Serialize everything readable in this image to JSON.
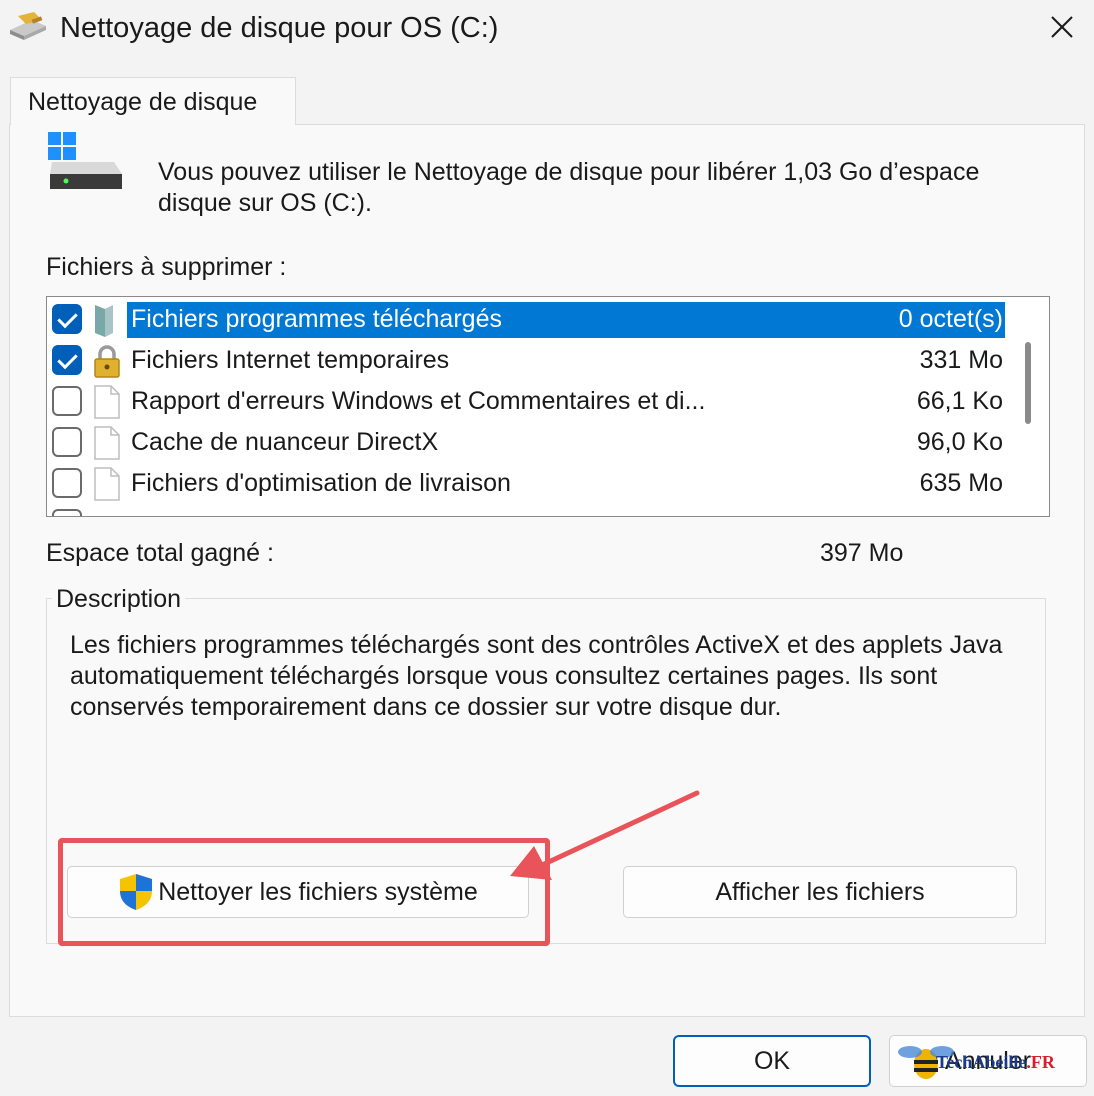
{
  "window": {
    "title": "Nettoyage de disque pour OS (C:)"
  },
  "tabs": [
    {
      "label": "Nettoyage de disque"
    }
  ],
  "intro": {
    "text": "Vous pouvez utiliser le Nettoyage de disque pour libérer 1,03 Go d’espace disque sur OS (C:)."
  },
  "files_label": "Fichiers à supprimer :",
  "files": [
    {
      "name": "Fichiers programmes téléchargés",
      "size": "0 octet(s)",
      "checked": true,
      "selected": true,
      "icon": "folder-icon"
    },
    {
      "name": "Fichiers Internet temporaires",
      "size": "331 Mo",
      "checked": true,
      "selected": false,
      "icon": "lock-icon"
    },
    {
      "name": "Rapport d'erreurs Windows et Commentaires et di...",
      "size": "66,1 Ko",
      "checked": false,
      "selected": false,
      "icon": "file-icon"
    },
    {
      "name": "Cache de nuanceur DirectX",
      "size": "96,0 Ko",
      "checked": false,
      "selected": false,
      "icon": "file-icon"
    },
    {
      "name": "Fichiers d'optimisation de livraison",
      "size": "635 Mo",
      "checked": false,
      "selected": false,
      "icon": "file-icon"
    }
  ],
  "total": {
    "label": "Espace total gagné :",
    "value": "397 Mo"
  },
  "description": {
    "title": "Description",
    "text": "Les fichiers programmes téléchargés sont des contrôles ActiveX et des applets Java automatiquement téléchargés lorsque vous consultez certaines pages. Ils sont conservés temporairement dans ce dossier sur votre disque dur."
  },
  "buttons": {
    "clean_system": "Nettoyer les fichiers système",
    "view_files": "Afficher les fichiers",
    "ok": "OK",
    "cancel": "Annuler"
  },
  "watermark": {
    "brand": "TechAbeille",
    "tld": ".FR"
  },
  "colors": {
    "accent": "#005fb8",
    "selection": "#0078d4",
    "annotation": "#e9545a"
  }
}
